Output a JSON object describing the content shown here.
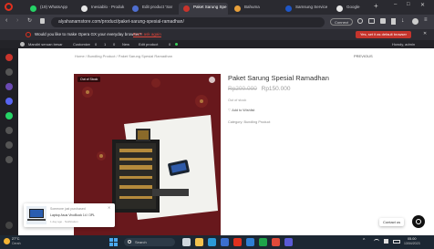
{
  "browser": {
    "tabs": [
      {
        "label": "(19) WhatsApp",
        "color": "#25d366"
      },
      {
        "label": "Inesiablo · Produk",
        "color": "#e6e6e6"
      },
      {
        "label": "Edit product 'Sar",
        "color": "#4f6fd1"
      },
      {
        "label": "Paket Sarung Spe",
        "color": "#c9342c",
        "active": true
      },
      {
        "label": "Bahuma",
        "color": "#e8a03a"
      },
      {
        "label": "Samsung Service",
        "color": "#1e56c7"
      },
      {
        "label": "Google",
        "color": "#e6e6e6"
      }
    ],
    "new_tab_symbol": "+",
    "window_controls": [
      "–",
      "□",
      "✕"
    ],
    "url": "alyahanamstore.com/product/paket-sarung-spesial-ramadhan/",
    "url_badge": "Connect"
  },
  "default_prompt": {
    "question": "Would you like to make Opera GX your everyday browser?",
    "link": "Don't ask again",
    "button": "Yes, set it as default browser"
  },
  "bookmark_bar": {
    "items": [
      "Mandiri seruan besar",
      "Customize",
      "0",
      "1",
      "0",
      "New",
      "Edit product",
      "0"
    ],
    "right_label": "Howdy, admin"
  },
  "product": {
    "breadcrumb": "Home / Bundling Product / Paket Sarung Spesial Ramadhan",
    "previous_label": "PREVIOUS",
    "title": "Paket Sarung Spesial Ramadhan",
    "old_price": "Rp200.000",
    "new_price": "Rp150.000",
    "stock": "Out of stock",
    "wishlist": "Add to Wishlist",
    "category": "Category: Bundling Product",
    "image_badge": "Out of Stock"
  },
  "popup": {
    "line1": "Someone just purchased",
    "line2": "Laptop Asus VivoBook 14 I 3PL",
    "line3": "1 day ago  ·  Notification"
  },
  "contact_button": "Contact us",
  "taskbar": {
    "weather_temp": "27°C",
    "weather_desc": "Cerah",
    "search_placeholder": "Search",
    "time": "05.00",
    "date": "13/04/2023"
  },
  "colors": {
    "accent": "#c9342c",
    "link_blue": "#2a67c8",
    "price_old": "#9a9a9a",
    "price_new": "#9a9a9a"
  }
}
